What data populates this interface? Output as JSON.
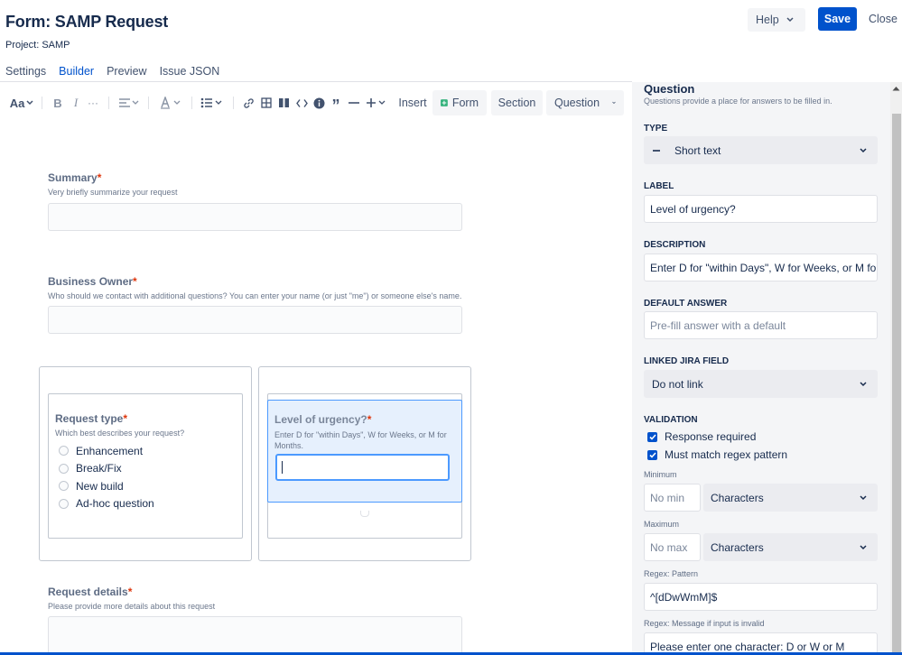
{
  "header": {
    "title": "Form: SAMP Request",
    "project": "Project: SAMP",
    "help_label": "Help",
    "save_label": "Save",
    "close_label": "Close"
  },
  "tabs": [
    "Settings",
    "Builder",
    "Preview",
    "Issue JSON"
  ],
  "toolbar": {
    "text_style": "Aa",
    "insert_label": "Insert",
    "form_label": "Form",
    "section_label": "Section",
    "question_label": "Question",
    "form_icon_color": "#36b37e"
  },
  "canvas": {
    "summary": {
      "label": "Summary",
      "desc": "Very briefly summarize your request"
    },
    "business_owner": {
      "label": "Business Owner",
      "desc": "Who should we contact with additional questions? You can enter your name (or just \"me\") or someone else's name."
    },
    "request_type": {
      "label": "Request type",
      "desc": "Which best describes your request?",
      "options": [
        "Enhancement",
        "Break/Fix",
        "New build",
        "Ad-hoc question"
      ]
    },
    "urgency": {
      "label": "Level of urgency?",
      "desc": "Enter D for \"within Days\", W for Weeks, or M for Months."
    },
    "request_details": {
      "label": "Request details",
      "desc": "Please provide more details about this request"
    },
    "required_mark": "*"
  },
  "panel": {
    "title": "Question",
    "subtitle": "Questions provide a place for answers to be filled in.",
    "type_label": "TYPE",
    "type_value": "Short text",
    "label_label": "LABEL",
    "label_value": "Level of urgency?",
    "description_label": "DESCRIPTION",
    "description_value": "Enter D for \"within Days\", W for Weeks, or M for Months.",
    "default_label": "DEFAULT ANSWER",
    "default_placeholder": "Pre-fill answer with a default",
    "linked_label": "LINKED JIRA FIELD",
    "linked_value": "Do not link",
    "validation_label": "VALIDATION",
    "response_required": "Response required",
    "regex_match": "Must match regex pattern",
    "minimum_label": "Minimum",
    "min_placeholder": "No min",
    "min_unit": "Characters",
    "maximum_label": "Maximum",
    "max_placeholder": "No max",
    "max_unit": "Characters",
    "regex_pattern_label": "Regex: Pattern",
    "regex_pattern_value": "^[dDwWmM]$",
    "regex_message_label": "Regex: Message if input is invalid",
    "regex_message_value": "Please enter one character:  D or W or M"
  }
}
